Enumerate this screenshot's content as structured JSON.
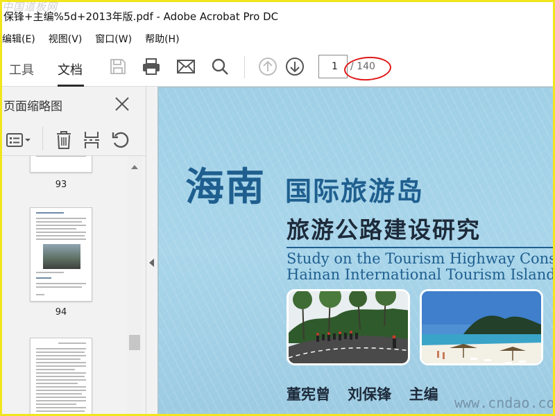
{
  "window": {
    "title": "保锋+主编%5d+2013年版.pdf - Adobe Acrobat Pro DC",
    "watermark_top": "中国道板网"
  },
  "menubar": {
    "items": [
      {
        "label": "编辑(E)"
      },
      {
        "label": "视图(V)"
      },
      {
        "label": "窗口(W)"
      },
      {
        "label": "帮助(H)"
      }
    ]
  },
  "toolbar": {
    "tabs": [
      {
        "label": "工具",
        "active": false
      },
      {
        "label": "文档",
        "active": true
      }
    ],
    "icons": [
      "save-icon",
      "print-icon",
      "email-icon",
      "search-icon",
      "previous-page-icon",
      "next-page-icon"
    ],
    "current_page": "1",
    "page_total": "/ 140"
  },
  "sidebar": {
    "title": "页面缩略图",
    "tools": [
      "page-options-icon",
      "delete-icon",
      "extract-icon",
      "rotate-icon"
    ],
    "thumbnails": [
      {
        "label": "93"
      },
      {
        "label": "94"
      },
      {
        "label": ""
      }
    ]
  },
  "document": {
    "title_main": "海南",
    "title_rest": "国际旅游岛",
    "subtitle": "旅游公路建设研究",
    "english_line1": "Study on the Tourism Highway Construction",
    "english_line2": "Hainan International Tourism Island",
    "editors": "董宪曾 刘保锋 主编",
    "watermark": "www.cndao.com"
  },
  "colors": {
    "accent_blue": "#1f5f8f",
    "cover_background": "#a8d5ea",
    "annotation_red": "#e01818",
    "window_border": "#f2e41d"
  }
}
